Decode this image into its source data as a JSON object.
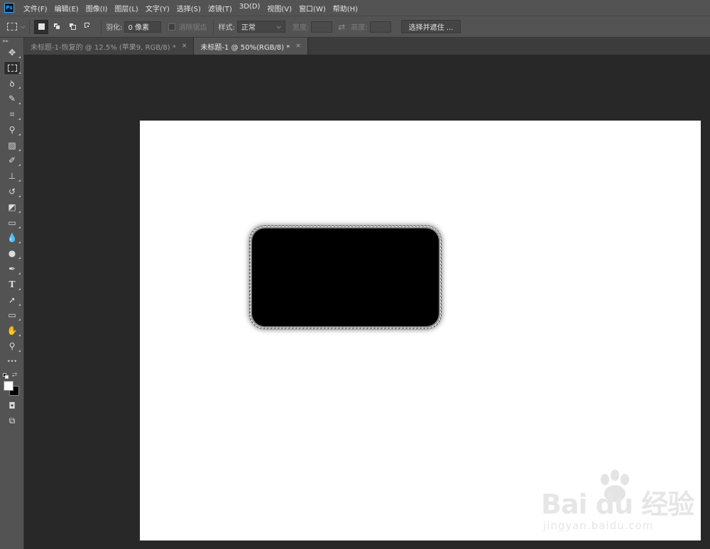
{
  "app": {
    "logo_text": "Ps"
  },
  "menu": [
    "文件(F)",
    "编辑(E)",
    "图像(I)",
    "图层(L)",
    "文字(Y)",
    "选择(S)",
    "滤镜(T)",
    "3D(D)",
    "视图(V)",
    "窗口(W)",
    "帮助(H)"
  ],
  "options": {
    "feather_label": "羽化:",
    "feather_value": "0 像素",
    "antialias_label": "消除锯齿",
    "style_label": "样式:",
    "style_value": "正常",
    "width_label": "宽度:",
    "height_label": "高度:",
    "select_mask_button": "选择并遮住 ..."
  },
  "tabs": [
    {
      "label": "未标题-1-恢复的 @ 12.5% (苹果9, RGB/8) *",
      "active": false
    },
    {
      "label": "未标题-1 @ 50%(RGB/8) *",
      "active": true
    }
  ],
  "tab_close_glyph": "×",
  "tools": [
    {
      "name": "move-tool",
      "icon": "move-icon",
      "glyph": "✥"
    },
    {
      "name": "marquee-tool",
      "icon": "rect-marquee-icon",
      "glyph": "",
      "active": true
    },
    {
      "name": "lasso-tool",
      "icon": "lasso-icon",
      "glyph": "ꝺ"
    },
    {
      "name": "quick-select-tool",
      "icon": "quick-select-icon",
      "glyph": "✎"
    },
    {
      "name": "crop-tool",
      "icon": "crop-icon",
      "glyph": "⌗"
    },
    {
      "name": "eyedropper-tool",
      "icon": "eyedropper-icon",
      "glyph": "⚲"
    },
    {
      "name": "healing-brush-tool",
      "icon": "bandage-icon",
      "glyph": "▨"
    },
    {
      "name": "brush-tool",
      "icon": "brush-icon",
      "glyph": "✐"
    },
    {
      "name": "clone-stamp-tool",
      "icon": "stamp-icon",
      "glyph": "⊥"
    },
    {
      "name": "history-brush-tool",
      "icon": "history-brush-icon",
      "glyph": "↺"
    },
    {
      "name": "eraser-tool",
      "icon": "eraser-icon",
      "glyph": "◩"
    },
    {
      "name": "gradient-tool",
      "icon": "gradient-icon",
      "glyph": "▭"
    },
    {
      "name": "blur-tool",
      "icon": "drop-icon",
      "glyph": "💧"
    },
    {
      "name": "dodge-tool",
      "icon": "dodge-icon",
      "glyph": "●"
    },
    {
      "name": "pen-tool",
      "icon": "pen-icon",
      "glyph": "✒"
    },
    {
      "name": "type-tool",
      "icon": "type-icon",
      "glyph": "T"
    },
    {
      "name": "path-select-tool",
      "icon": "arrow-icon",
      "glyph": "➚"
    },
    {
      "name": "rectangle-tool",
      "icon": "rectangle-icon",
      "glyph": "▭"
    },
    {
      "name": "hand-tool",
      "icon": "hand-icon",
      "glyph": "✋"
    },
    {
      "name": "zoom-tool",
      "icon": "zoom-icon",
      "glyph": "⚲"
    },
    {
      "name": "more-tools",
      "icon": "ellipsis-icon",
      "glyph": "•••"
    }
  ],
  "quick_mask_glyph": "◘",
  "screen_mode_glyph": "⧉",
  "colors": {
    "foreground": "#ffffff",
    "background": "#000000"
  },
  "watermark": {
    "main": "Bai du 经验",
    "sub": "jingyan.baidu.com"
  }
}
